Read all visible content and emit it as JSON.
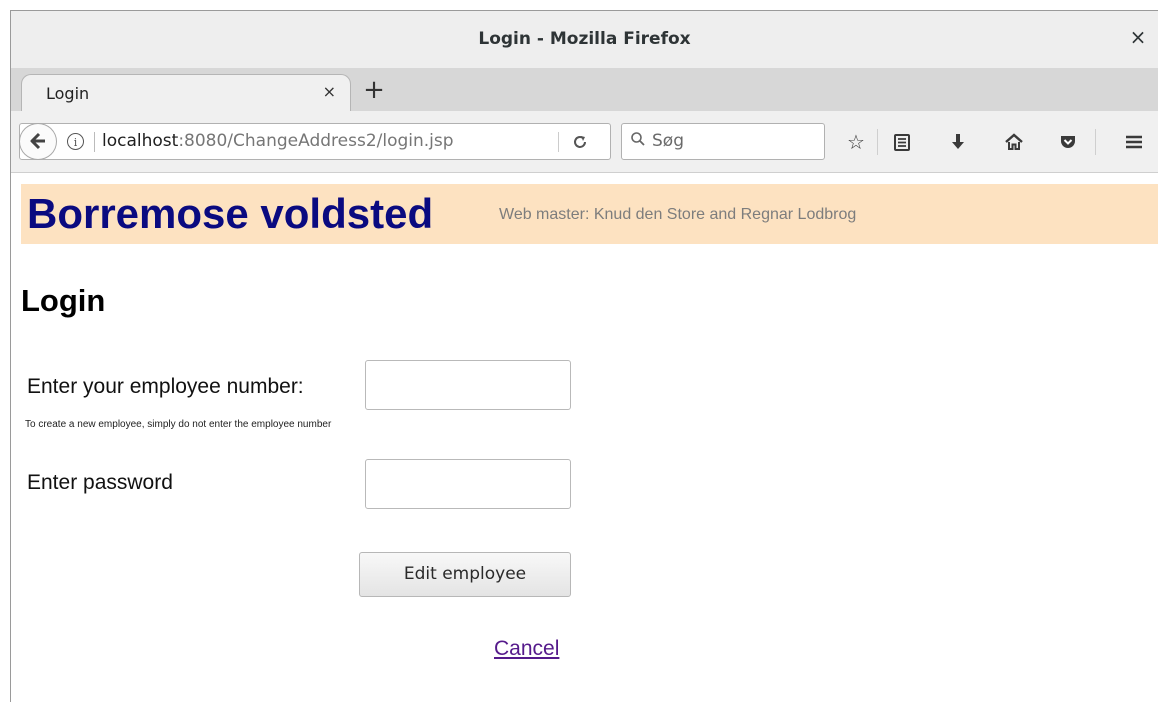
{
  "window": {
    "title": "Login - Mozilla Firefox",
    "close_icon": "×"
  },
  "tabs": [
    {
      "label": "Login",
      "close_icon": "×"
    }
  ],
  "new_tab_icon": "+",
  "navbar": {
    "back_icon": "🡐",
    "info_icon": "i",
    "url_host": "localhost",
    "url_rest": ":8080/ChangeAddress2/login.jsp",
    "reload_icon": "C",
    "search_placeholder": "Søg",
    "search_icon": "⚲",
    "bookmark_icon": "☆",
    "reader_icon": "≣",
    "download_icon": "⬇",
    "home_icon": "⌂",
    "pocket_icon": "⛉",
    "menu_icon": "≡"
  },
  "page": {
    "site_title": "Borremose voldsted",
    "webmaster": "Web master: Knud den Store and Regnar Lodbrog",
    "heading": "Login",
    "employee_label": "Enter your employee number:",
    "employee_hint": "To create a new employee, simply do not enter the employee number",
    "employee_value": "",
    "password_label": "Enter password",
    "password_value": "",
    "edit_button": "Edit employee",
    "cancel_link": "Cancel"
  },
  "colors": {
    "banner_bg": "#fde2c1",
    "site_title": "#0a0a80",
    "link_visited": "#551a8b"
  }
}
